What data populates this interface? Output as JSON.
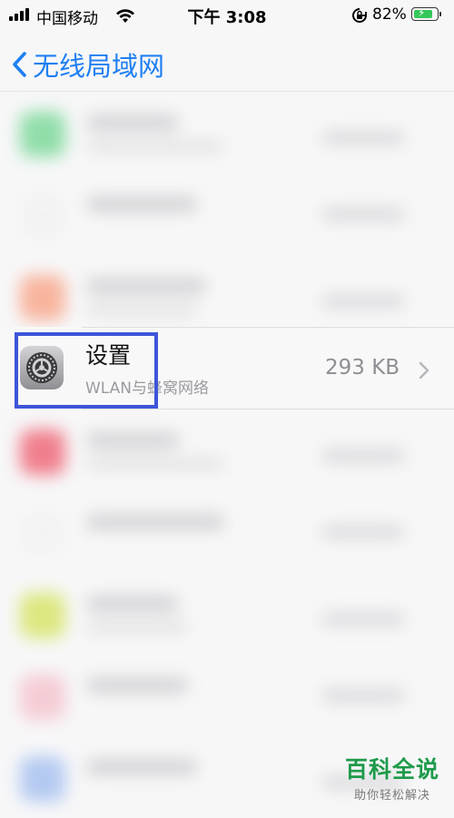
{
  "status_bar": {
    "carrier": "中国移动",
    "time": "下午 3:08",
    "battery_percent": "82%",
    "battery_level": 0.82,
    "battery_color": "#34c759"
  },
  "nav": {
    "back_icon": "chevron-left-icon",
    "title": "无线局域网"
  },
  "selected_app": {
    "name": "设置",
    "subtitle": "WLAN与蜂窝网络",
    "size": "293 KB",
    "icon": "gear-icon"
  },
  "highlight_color": "#3d55d8",
  "watermark": {
    "title": "百科全说",
    "subtitle": "助你轻松解决",
    "color": "#1e9a4a"
  }
}
